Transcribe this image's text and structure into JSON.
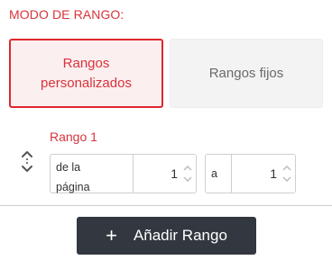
{
  "mode_section": {
    "title": "MODO DE RANGO:",
    "custom_label": "Rangos personalizados",
    "fixed_label": "Rangos fijos",
    "selected": "custom"
  },
  "range": {
    "title": "Rango 1",
    "from_label_line1": "de la",
    "from_label_line2": "página",
    "from_value": "1",
    "to_label": "a",
    "to_value": "1"
  },
  "add_button": {
    "plus": "+",
    "label": "Añadir Rango"
  },
  "colors": {
    "accent": "#d9333b",
    "accent_border": "#e0262d",
    "button_dark": "#33373f"
  },
  "icons": {
    "sort": "sort-updown-icon",
    "spinner_up": "chevron-up-icon",
    "spinner_down": "chevron-down-icon",
    "plus": "plus-icon"
  }
}
